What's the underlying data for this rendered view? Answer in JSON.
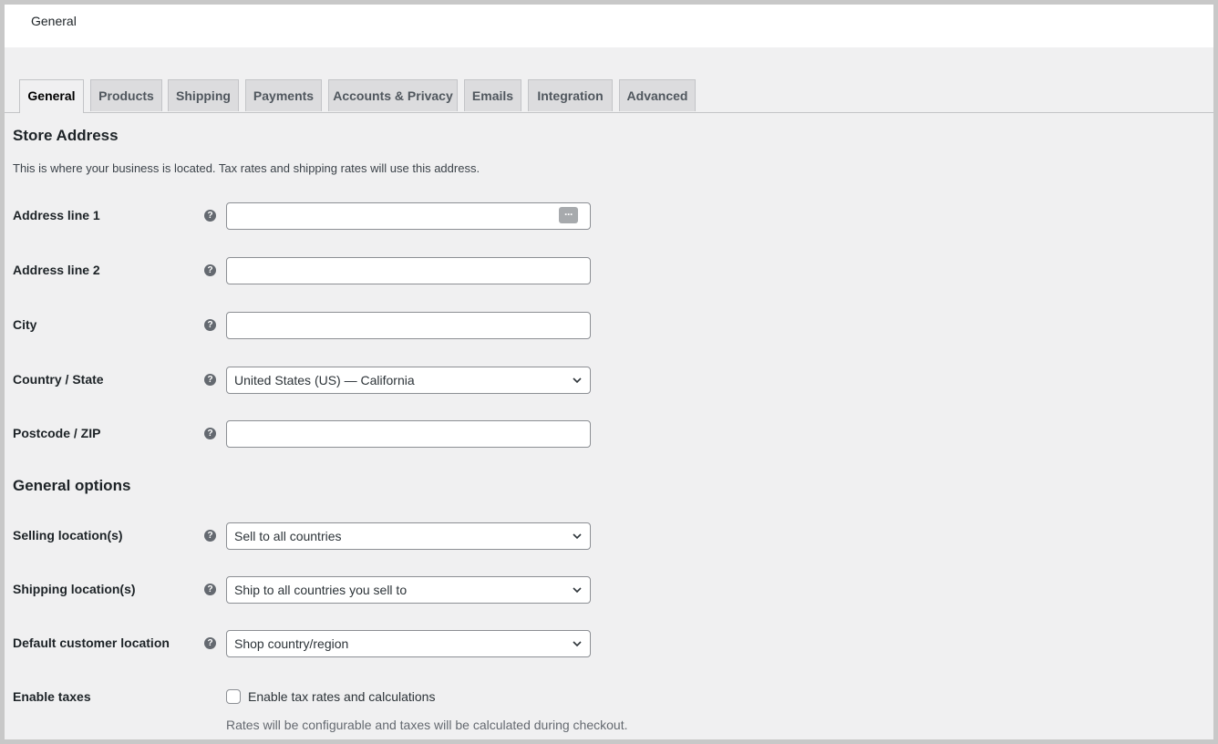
{
  "header": {
    "title": "General"
  },
  "tabs": [
    {
      "label": "General",
      "active": true
    },
    {
      "label": "Products"
    },
    {
      "label": "Shipping"
    },
    {
      "label": "Payments"
    },
    {
      "label": "Accounts & Privacy"
    },
    {
      "label": "Emails"
    },
    {
      "label": "Integration"
    },
    {
      "label": "Advanced"
    }
  ],
  "store_address": {
    "title": "Store Address",
    "description": "This is where your business is located. Tax rates and shipping rates will use this address.",
    "address1": {
      "label": "Address line 1",
      "value": ""
    },
    "address2": {
      "label": "Address line 2",
      "value": ""
    },
    "city": {
      "label": "City",
      "value": ""
    },
    "country": {
      "label": "Country / State",
      "value": "United States (US) — California"
    },
    "postcode": {
      "label": "Postcode / ZIP",
      "value": ""
    }
  },
  "general_options": {
    "title": "General options",
    "selling": {
      "label": "Selling location(s)",
      "value": "Sell to all countries"
    },
    "shipping": {
      "label": "Shipping location(s)",
      "value": "Ship to all countries you sell to"
    },
    "default_location": {
      "label": "Default customer location",
      "value": "Shop country/region"
    },
    "taxes": {
      "label": "Enable taxes",
      "checkbox_label": "Enable tax rates and calculations",
      "checked": false,
      "hint": "Rates will be configurable and taxes will be calculated during checkout."
    }
  },
  "icons": {
    "help": "question-mark-circle-icon",
    "password_manager": "password-manager-icon",
    "chevron": "chevron-down-icon"
  }
}
